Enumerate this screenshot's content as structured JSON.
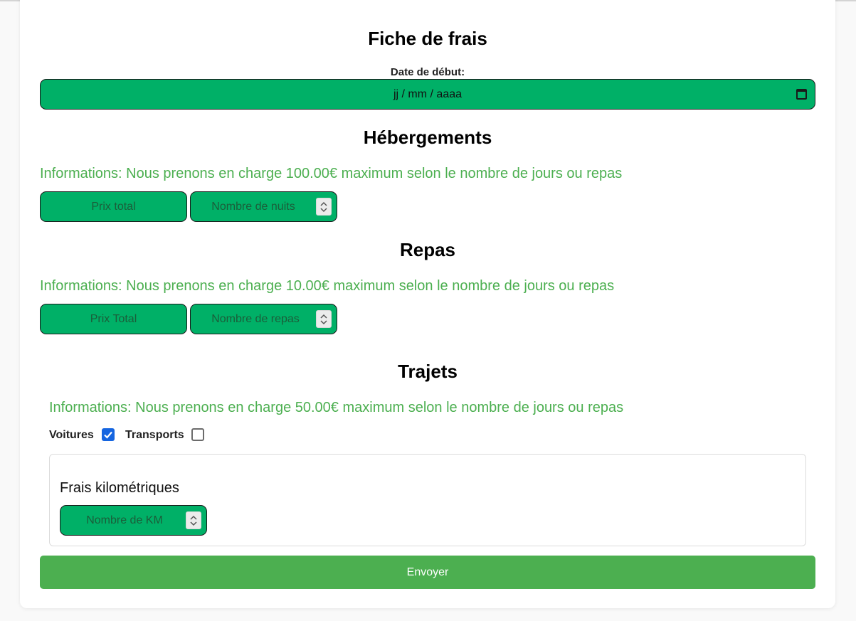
{
  "title": "Fiche de frais",
  "date": {
    "label": "Date de début:",
    "placeholder": "jj / mm / aaaa"
  },
  "hebergements": {
    "heading": "Hébergements",
    "info": "Informations: Nous prenons en charge 100.00€ maximum selon le nombre de jours ou repas",
    "price_placeholder": "Prix total",
    "count_placeholder": "Nombre de nuits"
  },
  "repas": {
    "heading": "Repas",
    "info": "Informations: Nous prenons en charge 10.00€ maximum selon le nombre de jours ou repas",
    "price_placeholder": "Prix Total",
    "count_placeholder": "Nombre de repas"
  },
  "trajets": {
    "heading": "Trajets",
    "info": "Informations: Nous prenons en charge 50.00€ maximum selon le nombre de jours ou repas",
    "voitures_label": "Voitures",
    "voitures_checked": true,
    "transports_label": "Transports",
    "transports_checked": false,
    "frais_title": "Frais kilométriques",
    "km_placeholder": "Nombre de KM"
  },
  "submit_label": "Envoyer",
  "colors": {
    "field": "#00b067",
    "info_text": "#4caf50",
    "button": "#4caf50",
    "checkbox": "#1565e0"
  },
  "icons": {
    "calendar": "calendar-icon",
    "spinner": "spinner-icon"
  }
}
